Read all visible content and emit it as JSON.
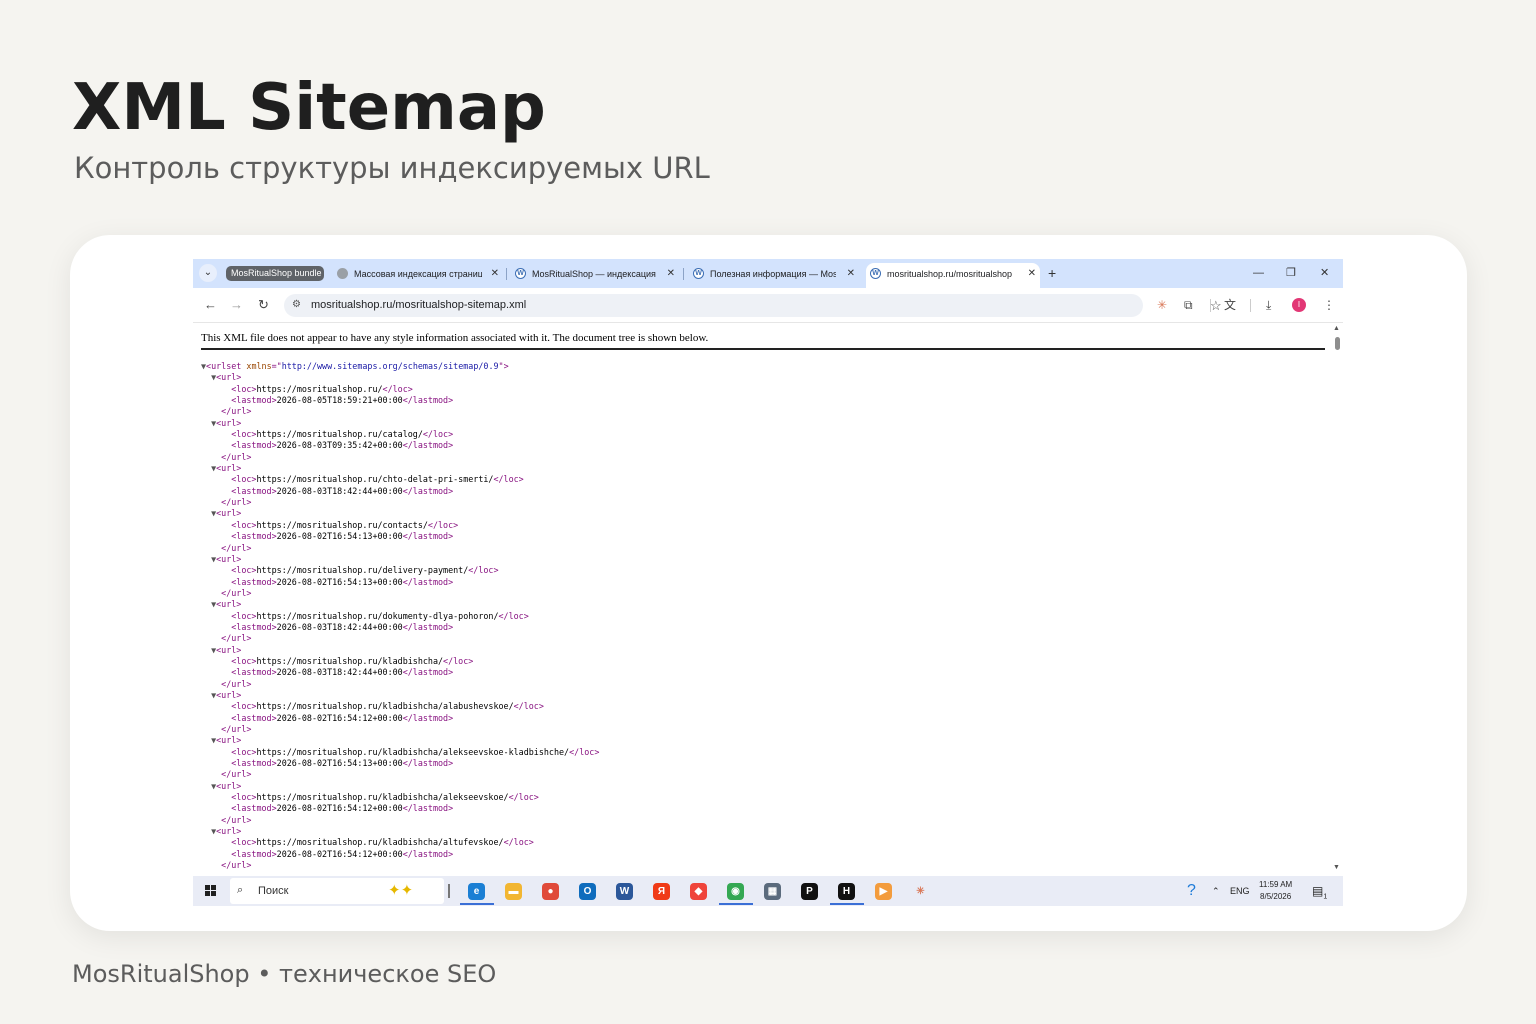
{
  "header": {
    "title": "XML Sitemap",
    "subtitle": "Контроль структуры индексируемых URL"
  },
  "footer": {
    "text": "MosRitualShop • техническое SEO"
  },
  "browser": {
    "tab_group_label": "MosRitualShop bundle",
    "tabs": [
      {
        "label": "Массовая индексация страниц",
        "icon": "globe-icon"
      },
      {
        "label": "MosRitualShop — индексация",
        "icon": "wordpress-icon"
      },
      {
        "label": "Полезная информация — Mos",
        "icon": "wordpress-icon"
      },
      {
        "label": "mosritualshop.ru/mosritualshop",
        "icon": "wordpress-icon",
        "active": true
      }
    ],
    "new_tab": "+",
    "window_controls": {
      "minimize": "—",
      "restore": "❐",
      "close": "✕"
    },
    "url": "mosritualshop.ru/mosritualshop-sitemap.xml",
    "avatar_letter": "I"
  },
  "xml_viewer": {
    "notice": "This XML file does not appear to have any style information associated with it. The document tree is shown below.",
    "root_tag": "urlset",
    "root_attr_name": "xmlns",
    "root_attr_value": "http://www.sitemaps.org/schemas/sitemap/0.9",
    "entries": [
      {
        "loc": "https://mosritualshop.ru/",
        "lastmod": "2026-08-05T18:59:21+00:00"
      },
      {
        "loc": "https://mosritualshop.ru/catalog/",
        "lastmod": "2026-08-03T09:35:42+00:00"
      },
      {
        "loc": "https://mosritualshop.ru/chto-delat-pri-smerti/",
        "lastmod": "2026-08-03T18:42:44+00:00"
      },
      {
        "loc": "https://mosritualshop.ru/contacts/",
        "lastmod": "2026-08-02T16:54:13+00:00"
      },
      {
        "loc": "https://mosritualshop.ru/delivery-payment/",
        "lastmod": "2026-08-02T16:54:13+00:00"
      },
      {
        "loc": "https://mosritualshop.ru/dokumenty-dlya-pohoron/",
        "lastmod": "2026-08-03T18:42:44+00:00"
      },
      {
        "loc": "https://mosritualshop.ru/kladbishcha/",
        "lastmod": "2026-08-03T18:42:44+00:00"
      },
      {
        "loc": "https://mosritualshop.ru/kladbishcha/alabushevskoe/",
        "lastmod": "2026-08-02T16:54:12+00:00"
      },
      {
        "loc": "https://mosritualshop.ru/kladbishcha/alekseevskoe-kladbishche/",
        "lastmod": "2026-08-02T16:54:13+00:00"
      },
      {
        "loc": "https://mosritualshop.ru/kladbishcha/alekseevskoe/",
        "lastmod": "2026-08-02T16:54:12+00:00"
      },
      {
        "loc": "https://mosritualshop.ru/kladbishcha/altufevskoe/",
        "lastmod": "2026-08-02T16:54:12+00:00"
      }
    ]
  },
  "taskbar": {
    "search_placeholder": "Поиск",
    "language": "ENG",
    "time": "11:59 AM",
    "date": "8/5/2026",
    "notification_count": "1",
    "apps": [
      {
        "name": "edge-icon",
        "color": "#1b7fd4",
        "glyph": "e"
      },
      {
        "name": "file-explorer-icon",
        "color": "#f2b632",
        "glyph": "▬"
      },
      {
        "name": "paint-icon",
        "color": "#e04a3a",
        "glyph": "●"
      },
      {
        "name": "outlook-icon",
        "color": "#0f6cbd",
        "glyph": "O"
      },
      {
        "name": "word-icon",
        "color": "#2b579a",
        "glyph": "W"
      },
      {
        "name": "yandex-browser-icon",
        "color": "#f03a17",
        "glyph": "Я"
      },
      {
        "name": "anydesk-icon",
        "color": "#ef443b",
        "glyph": "◆"
      },
      {
        "name": "chrome-icon",
        "color": "#34a853",
        "glyph": "◉"
      },
      {
        "name": "calculator-icon",
        "color": "#5b6b7d",
        "glyph": "▦"
      },
      {
        "name": "pycharm-icon",
        "color": "#111111",
        "glyph": "P"
      },
      {
        "name": "hyper-icon",
        "color": "#111111",
        "glyph": "H"
      },
      {
        "name": "media-player-icon",
        "color": "#f39c3d",
        "glyph": "▶"
      },
      {
        "name": "claude-icon",
        "color": "#e9ecf6",
        "glyph": "✳"
      }
    ]
  }
}
